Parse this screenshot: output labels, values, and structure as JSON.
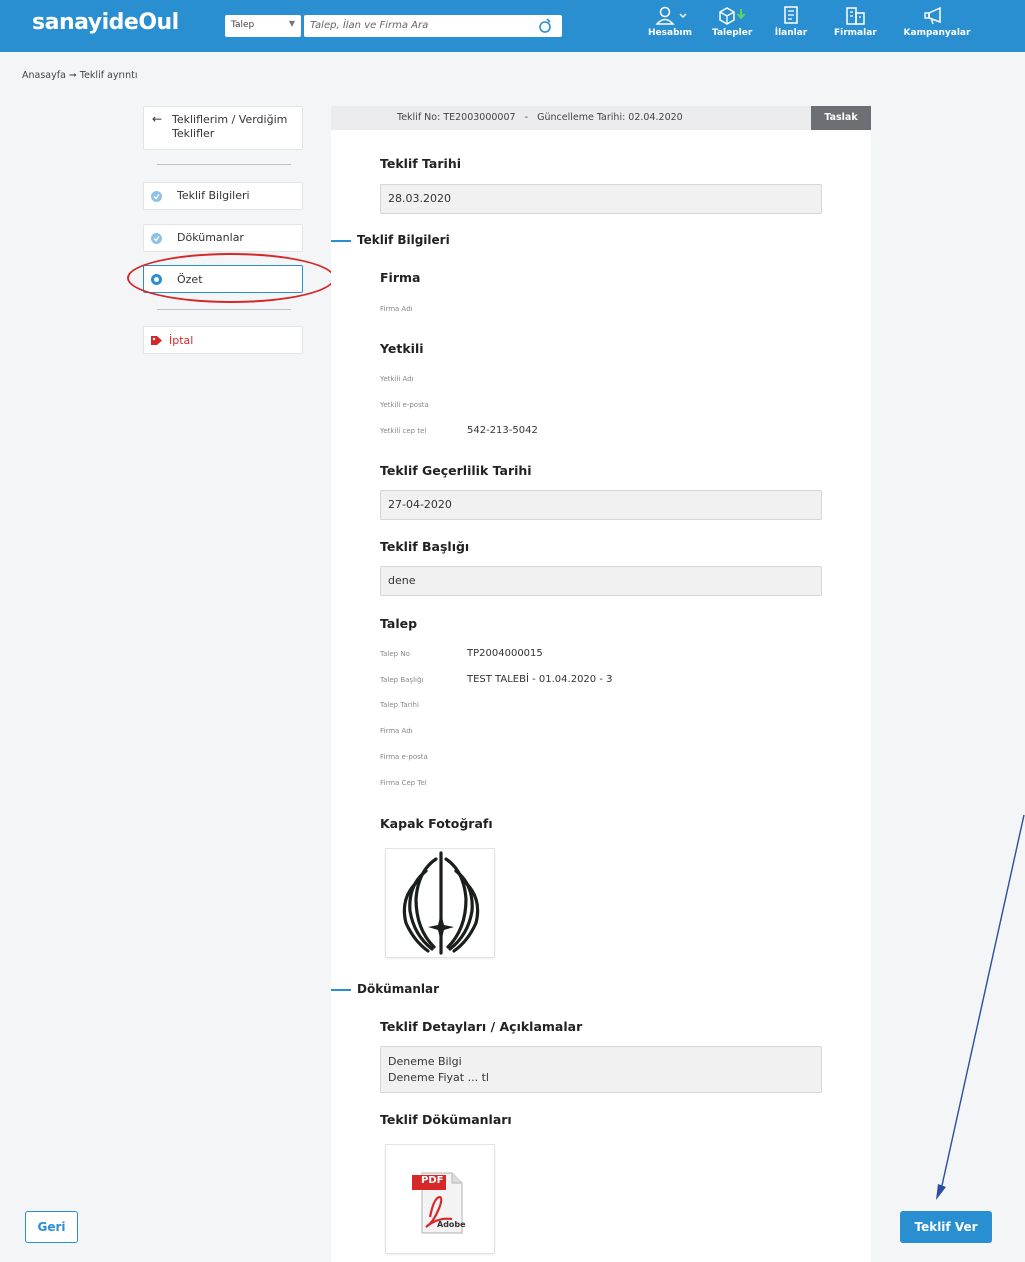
{
  "header": {
    "logo": "sanayideOul",
    "search_category": "Talep",
    "search_placeholder": "Talep, İlan ve Firma Ara",
    "nav": [
      {
        "label": "Hesabım",
        "icon": "user-icon"
      },
      {
        "label": "Talepler",
        "icon": "box-icon"
      },
      {
        "label": "İlanlar",
        "icon": "listing-icon"
      },
      {
        "label": "Firmalar",
        "icon": "building-icon"
      },
      {
        "label": "Kampanyalar",
        "icon": "megaphone-icon"
      }
    ]
  },
  "breadcrumb": "Anasayfa ➞ Teklif ayrıntı",
  "sidebar": {
    "back_link": "Tekliflerim / Verdiğim Teklifler",
    "items": [
      {
        "label": "Teklif Bilgileri",
        "state": "done"
      },
      {
        "label": "Dökümanlar",
        "state": "done"
      },
      {
        "label": "Özet",
        "state": "active"
      }
    ],
    "cancel": "İptal"
  },
  "offer": {
    "head": "Teklif No: TE2003000007   -   Güncelleme Tarihi: 02.04.2020",
    "status": "Taslak",
    "date_title": "Teklif Tarihi",
    "date_value": "28.03.2020",
    "section_info": "Teklif Bilgileri",
    "firma_title": "Firma",
    "firma_adi_label": "Firma Adı",
    "yetkili_title": "Yetkili",
    "yetkili_adi_label": "Yetkili Adı",
    "yetkili_email_label": "Yetkili e-posta",
    "yetkili_tel_label": "Yetkili cep tel",
    "yetkili_tel_value": "542-213-5042",
    "gecerlilik_title": "Teklif Geçerlilik Tarihi",
    "gecerlilik_value": "27-04-2020",
    "baslik_title": "Teklif Başlığı",
    "baslik_value": "dene",
    "talep_title": "Talep",
    "talep_no_label": "Talep No",
    "talep_no_value": "TP2004000015",
    "talep_baslik_label": "Talep Başlığı",
    "talep_baslik_value": "TEST TALEBİ - 01.04.2020 - 3",
    "talep_tarihi_label": "Talep Tarihi",
    "talep_firma_label": "Firma Adı",
    "talep_email_label": "Firma e-posta",
    "talep_tel_label": "Firma Cep Tel",
    "kapak_title": "Kapak Fotoğrafı",
    "section_docs": "Dökümanlar",
    "detay_title": "Teklif Detayları / Açıklamalar",
    "detay_line1": "Deneme Bilgi",
    "detay_line2": "Deneme Fiyat ... tl",
    "dokuman_title": "Teklif Dökümanları",
    "pdf_label": "PDF",
    "adobe_label": "Adobe"
  },
  "buttons": {
    "back": "Geri",
    "submit": "Teklif Ver"
  },
  "colors": {
    "brand": "#2a8fd1",
    "danger": "#d62828",
    "badge": "#6c6f73"
  }
}
